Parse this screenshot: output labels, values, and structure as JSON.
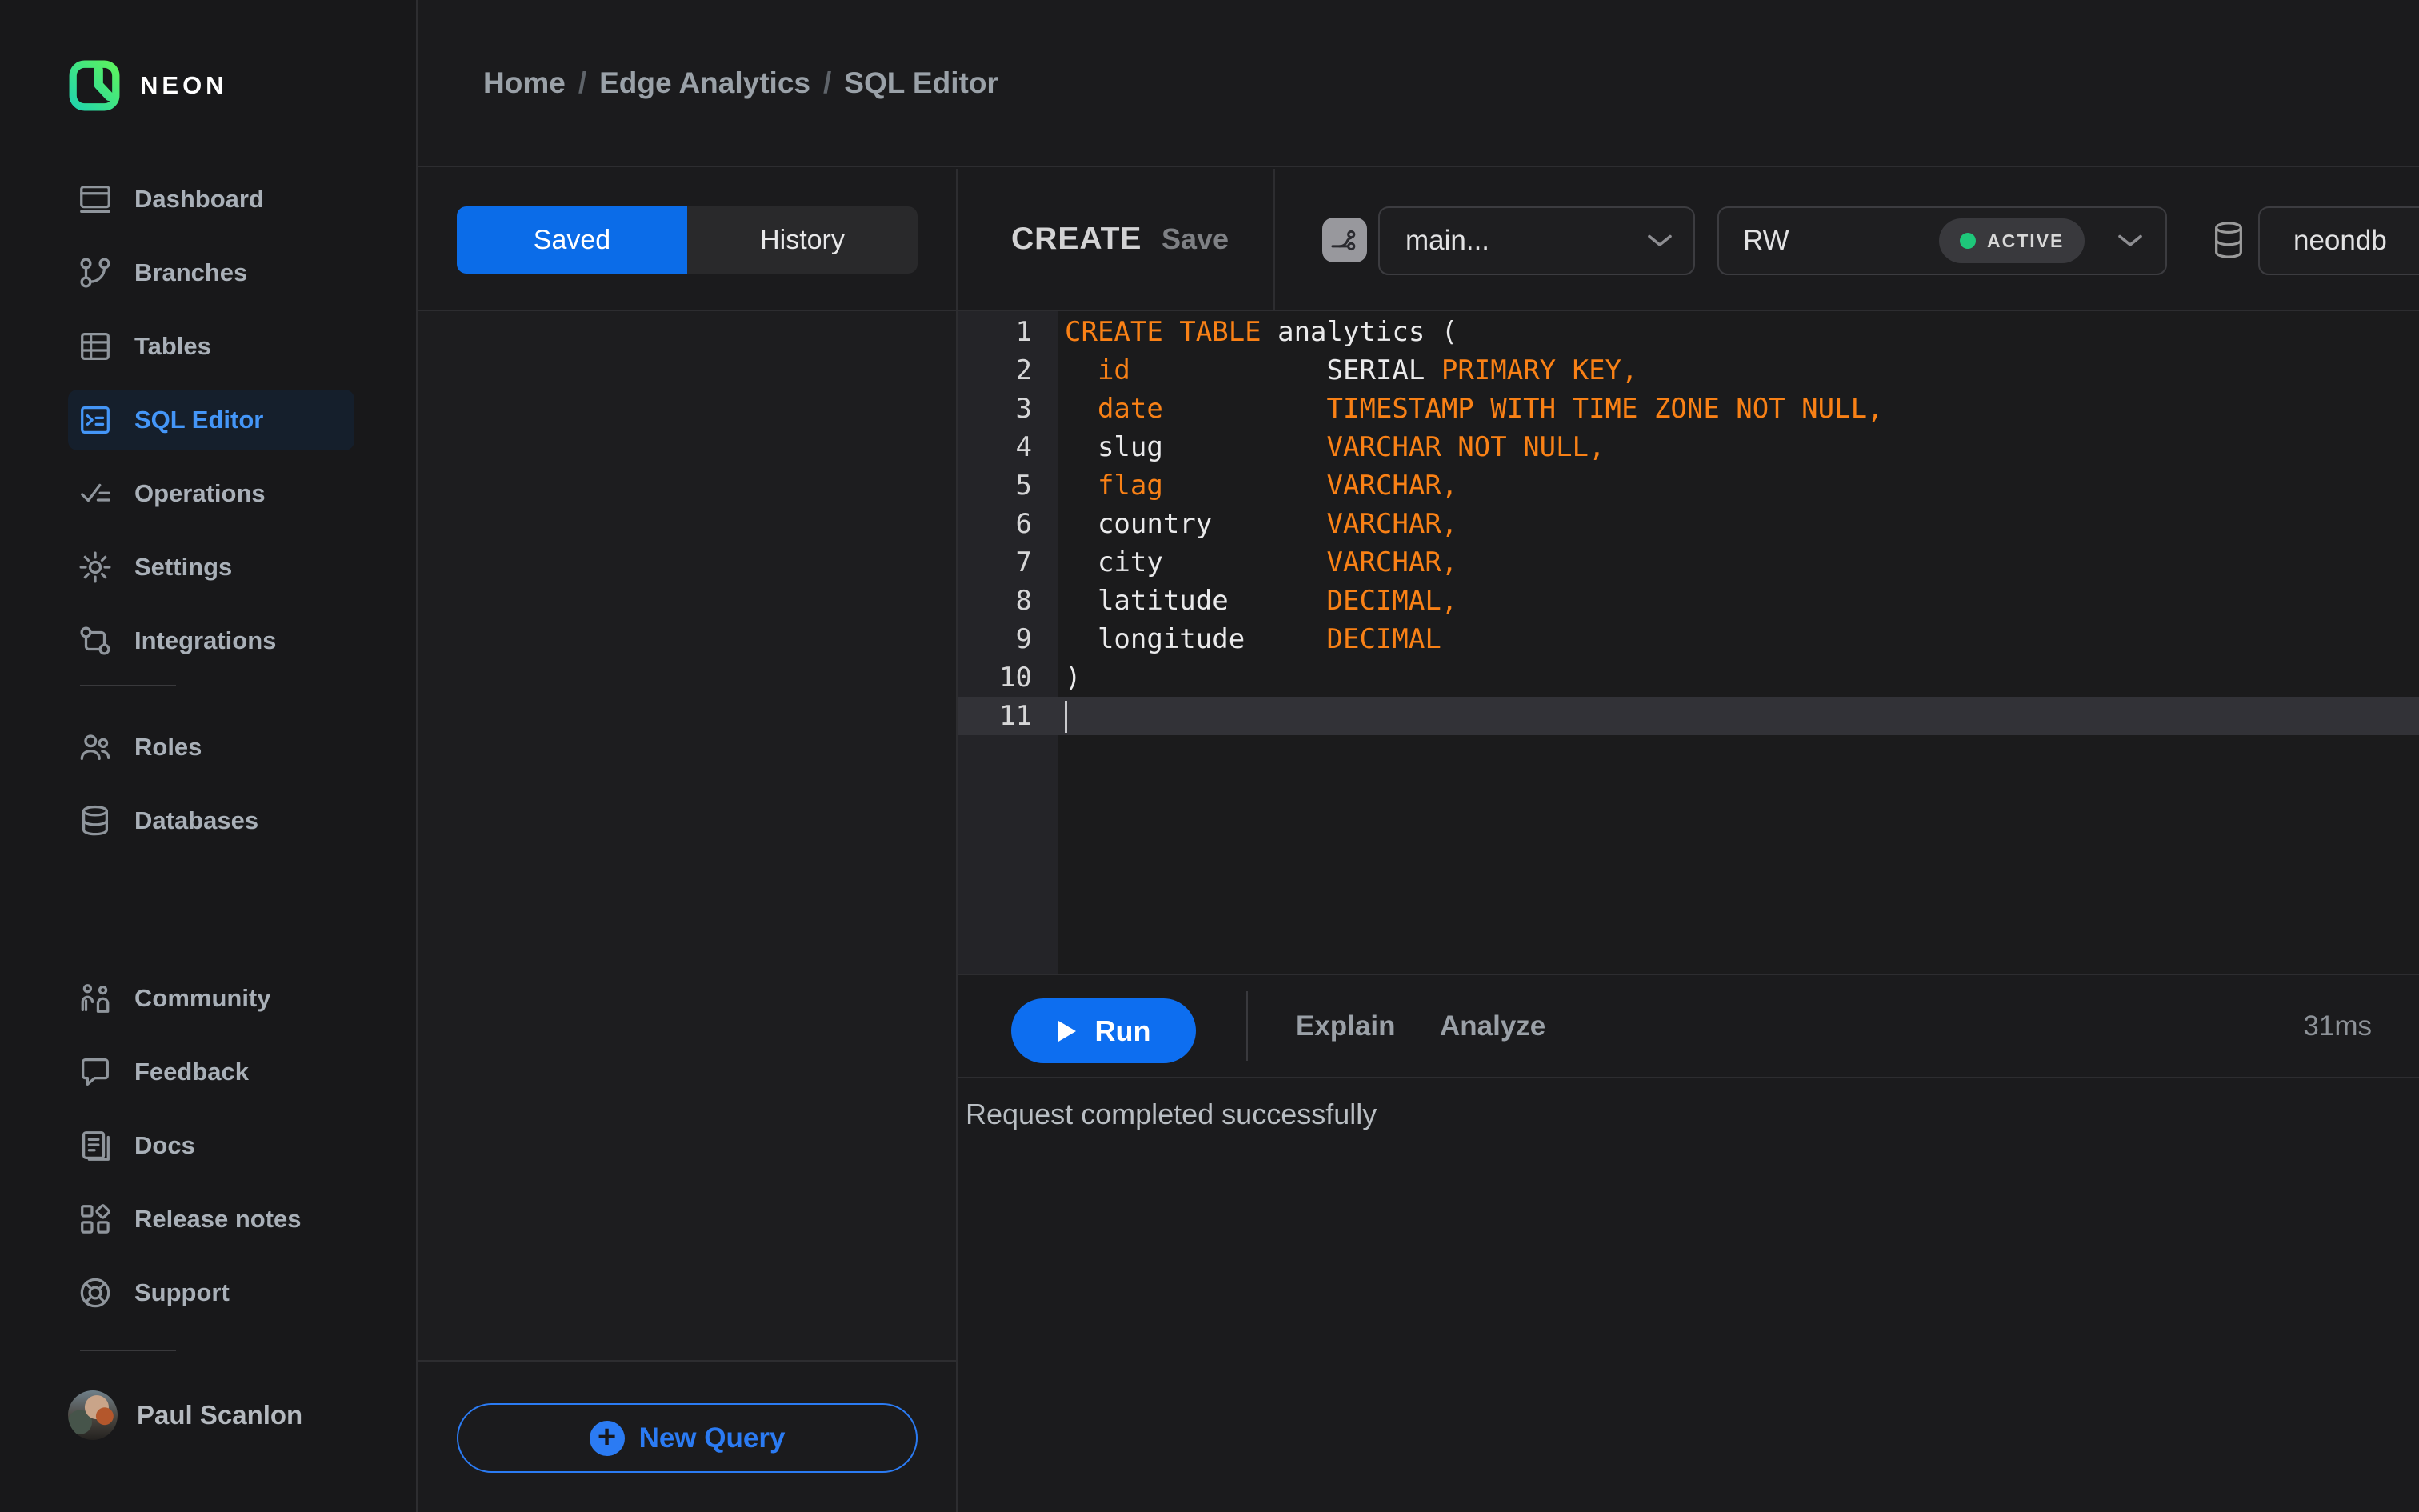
{
  "app": {
    "brand": "NEON"
  },
  "breadcrumb": {
    "separator": "/",
    "items": [
      "Home",
      "Edge Analytics",
      "SQL Editor"
    ]
  },
  "sidebar": {
    "sections": [
      {
        "name": "main",
        "items": [
          {
            "icon": "dashboard-icon",
            "label": "Dashboard",
            "active": false
          },
          {
            "icon": "branches-icon",
            "label": "Branches",
            "active": false
          },
          {
            "icon": "tables-icon",
            "label": "Tables",
            "active": false
          },
          {
            "icon": "sql-editor-icon",
            "label": "SQL Editor",
            "active": true
          },
          {
            "icon": "operations-icon",
            "label": "Operations",
            "active": false
          },
          {
            "icon": "settings-icon",
            "label": "Settings",
            "active": false
          },
          {
            "icon": "integrations-icon",
            "label": "Integrations",
            "active": false
          }
        ]
      },
      {
        "name": "branch-resources",
        "items": [
          {
            "icon": "roles-icon",
            "label": "Roles",
            "active": false
          },
          {
            "icon": "databases-icon",
            "label": "Databases",
            "active": false
          }
        ]
      },
      {
        "name": "footer",
        "items": [
          {
            "icon": "community-icon",
            "label": "Community",
            "active": false
          },
          {
            "icon": "feedback-icon",
            "label": "Feedback",
            "active": false
          },
          {
            "icon": "docs-icon",
            "label": "Docs",
            "active": false
          },
          {
            "icon": "release-notes-icon",
            "label": "Release notes",
            "active": false
          },
          {
            "icon": "support-icon",
            "label": "Support",
            "active": false
          }
        ]
      }
    ],
    "user": {
      "name": "Paul Scanlon"
    }
  },
  "query_panel": {
    "tabs": [
      {
        "label": "Saved",
        "active": true
      },
      {
        "label": "History",
        "active": false
      }
    ],
    "new_query_label": "New Query"
  },
  "editor": {
    "toolbar": {
      "title": "CREATE",
      "save_label": "Save",
      "branch": "main...",
      "compute": "RW",
      "compute_status": "ACTIVE",
      "database": "neondb"
    },
    "code": {
      "language": "sql",
      "active_line": 11,
      "lines": [
        {
          "num": 1,
          "tokens": [
            [
              "k",
              "CREATE TABLE"
            ],
            [
              "p",
              " analytics ("
            ]
          ]
        },
        {
          "num": 2,
          "tokens": [
            [
              "p",
              "  "
            ],
            [
              "k",
              "id"
            ],
            [
              "p",
              "            SERIAL "
            ],
            [
              "k",
              "PRIMARY KEY,"
            ]
          ]
        },
        {
          "num": 3,
          "tokens": [
            [
              "p",
              "  "
            ],
            [
              "k",
              "date"
            ],
            [
              "p",
              "          "
            ],
            [
              "k",
              "TIMESTAMP WITH TIME ZONE NOT NULL,"
            ]
          ]
        },
        {
          "num": 4,
          "tokens": [
            [
              "p",
              "  slug          "
            ],
            [
              "k",
              "VARCHAR NOT NULL,"
            ]
          ]
        },
        {
          "num": 5,
          "tokens": [
            [
              "p",
              "  "
            ],
            [
              "k",
              "flag"
            ],
            [
              "p",
              "          "
            ],
            [
              "k",
              "VARCHAR,"
            ]
          ]
        },
        {
          "num": 6,
          "tokens": [
            [
              "p",
              "  country       "
            ],
            [
              "k",
              "VARCHAR,"
            ]
          ]
        },
        {
          "num": 7,
          "tokens": [
            [
              "p",
              "  city          "
            ],
            [
              "k",
              "VARCHAR,"
            ]
          ]
        },
        {
          "num": 8,
          "tokens": [
            [
              "p",
              "  latitude      "
            ],
            [
              "k",
              "DECIMAL,"
            ]
          ]
        },
        {
          "num": 9,
          "tokens": [
            [
              "p",
              "  longitude     "
            ],
            [
              "k",
              "DECIMAL"
            ]
          ]
        },
        {
          "num": 10,
          "tokens": [
            [
              "p",
              ")"
            ]
          ]
        },
        {
          "num": 11,
          "tokens": []
        }
      ]
    },
    "run_bar": {
      "run_label": "Run",
      "explain_label": "Explain",
      "analyze_label": "Analyze",
      "duration": "31ms"
    },
    "status_message": "Request completed successfully"
  },
  "colors": {
    "accent_blue": "#0d6ef0",
    "tab_blue": "#0b6ce8",
    "outline_blue": "#2b7bf3",
    "code_orange": "#f98116",
    "status_green": "#1ec77a",
    "logo_green": "#63f655",
    "logo_teal": "#1ad1b6"
  }
}
